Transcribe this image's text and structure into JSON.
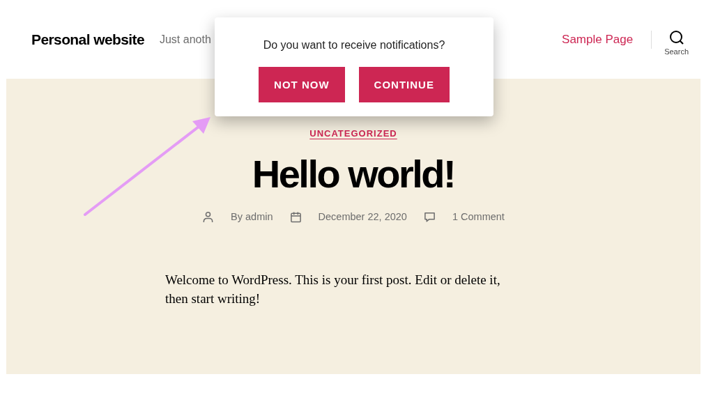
{
  "header": {
    "site_title": "Personal website",
    "tagline": "Just anoth",
    "nav": [
      {
        "label": "Sample Page"
      }
    ],
    "search": {
      "label": "Search"
    }
  },
  "post": {
    "category": "UNCATEGORIZED",
    "title": "Hello world!",
    "meta": [
      {
        "kind": "author",
        "text": "By admin"
      },
      {
        "kind": "date",
        "text": "December 22, 2020"
      },
      {
        "kind": "comments",
        "text": "1 Comment"
      }
    ],
    "body": "Welcome to WordPress. This is your first post. Edit or delete it, then start writing!"
  },
  "dialog": {
    "message": "Do you want to receive notifications?",
    "buttons": [
      {
        "label": "NOT NOW"
      },
      {
        "label": "CONTINUE"
      }
    ]
  }
}
